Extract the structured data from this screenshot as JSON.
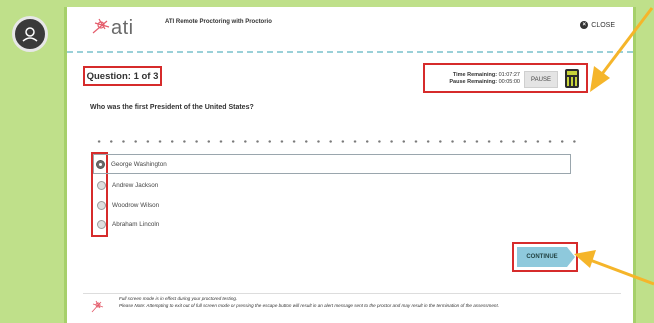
{
  "header": {
    "logo_text": "ati",
    "title": "ATI Remote Proctoring with Proctorio",
    "close_label": "CLOSE"
  },
  "question": {
    "number_label": "Question: 1 of 3",
    "text": "Who was the first President of the United States?"
  },
  "timer": {
    "time_remaining_label": "Time Remaining:",
    "time_remaining_value": "01:07:27",
    "pause_remaining_label": "Pause Remaining:",
    "pause_remaining_value": "00:05:00",
    "pause_label": "PAUSE"
  },
  "answers": [
    {
      "label": "George Washington",
      "selected": true
    },
    {
      "label": "Andrew Jackson",
      "selected": false
    },
    {
      "label": "Woodrow Wilson",
      "selected": false
    },
    {
      "label": "Abraham Lincoln",
      "selected": false
    }
  ],
  "actions": {
    "continue_label": "CONTINUE"
  },
  "footer": {
    "line1": "Full screen mode is in effect during your proctored testing.",
    "line2": "Please Note: Attempting to exit out of full screen mode or pressing the escape button will result in an alert message sent to the proctor and may result in the termination of the assessment."
  },
  "colors": {
    "highlight": "#d62b2b",
    "arrow": "#f5b52a",
    "continue": "#8ec9dc",
    "page_border": "#a6d06a"
  }
}
